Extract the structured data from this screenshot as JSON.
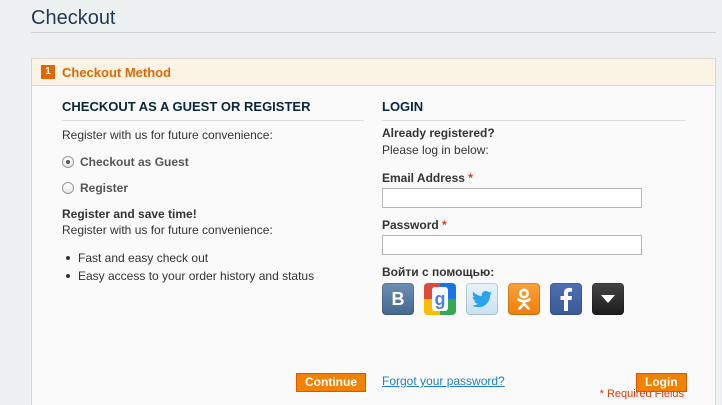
{
  "page": {
    "title": "Checkout"
  },
  "step": {
    "number": "1",
    "title": "Checkout Method"
  },
  "left": {
    "heading": "CHECKOUT AS A GUEST OR REGISTER",
    "intro": "Register with us for future convenience:",
    "options": [
      {
        "label": "Checkout as Guest",
        "checked": true
      },
      {
        "label": "Register",
        "checked": false
      }
    ],
    "benefits_title": "Register and save time!",
    "benefits_intro": "Register with us for future convenience:",
    "benefits": [
      "Fast and easy check out",
      "Easy access to your order history and status"
    ],
    "continue_label": "Continue"
  },
  "right": {
    "heading": "LOGIN",
    "already": "Already registered?",
    "please": "Please log in below:",
    "email_label": "Email Address",
    "password_label": "Password",
    "required_mark": "*",
    "email_value": "",
    "password_value": "",
    "social_label": "Войти с помощью:",
    "social_icons": [
      "vkontakte-icon",
      "google-icon",
      "twitter-icon",
      "odnoklassniki-icon",
      "facebook-icon",
      "more-dropdown-icon"
    ],
    "required_note": "* Required Fields",
    "forgot_label": "Forgot your password?",
    "login_label": "Login"
  },
  "colors": {
    "accent": "#f18200",
    "link": "#1e7ec8",
    "heading": "#0a263c",
    "required": "#eb340a"
  }
}
